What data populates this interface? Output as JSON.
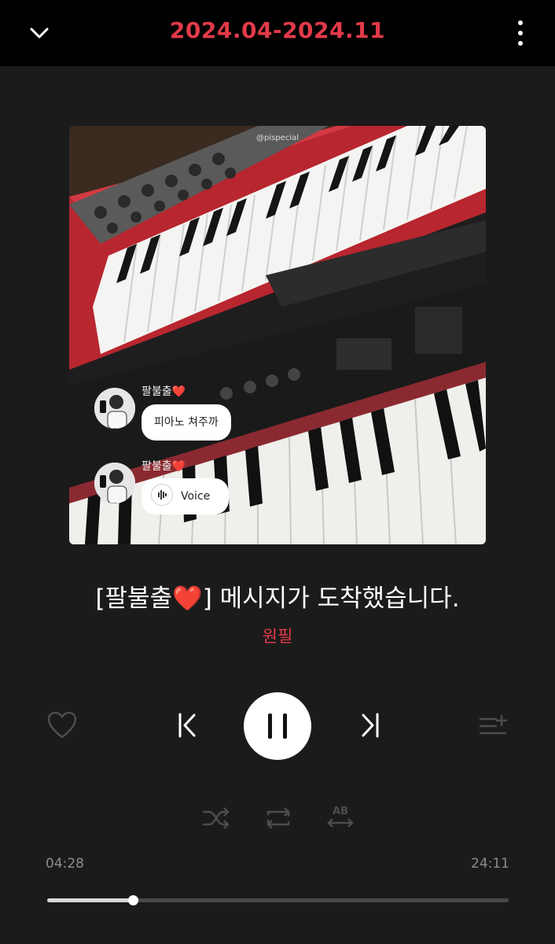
{
  "header": {
    "title": "2024.04-2024.11",
    "back_icon": "chevron-down-icon",
    "more_icon": "more-vertical-icon"
  },
  "artwork": {
    "watermark": "@pispecial",
    "messages": [
      {
        "sender": "팔불출❤️",
        "text": "피아노 쳐주까"
      },
      {
        "sender": "팔불출❤️",
        "text": "Voice",
        "icon": "voice-wave-icon"
      }
    ]
  },
  "track": {
    "title": "[팔불출❤️] 메시지가 도착했습니다.",
    "artist": "원필"
  },
  "controls": {
    "like_icon": "heart-outline-icon",
    "prev_icon": "skip-previous-icon",
    "play_icon": "pause-icon",
    "next_icon": "skip-next-icon",
    "queue_icon": "add-to-queue-icon",
    "shuffle_icon": "shuffle-icon",
    "repeat_icon": "repeat-icon",
    "ab_icon": "ab-repeat-icon"
  },
  "playback": {
    "elapsed": "04:28",
    "total": "24:11",
    "progress_fraction": 0.185
  },
  "colors": {
    "accent": "#e23a4a",
    "background": "#1b1b1b",
    "topbar": "#000000"
  }
}
